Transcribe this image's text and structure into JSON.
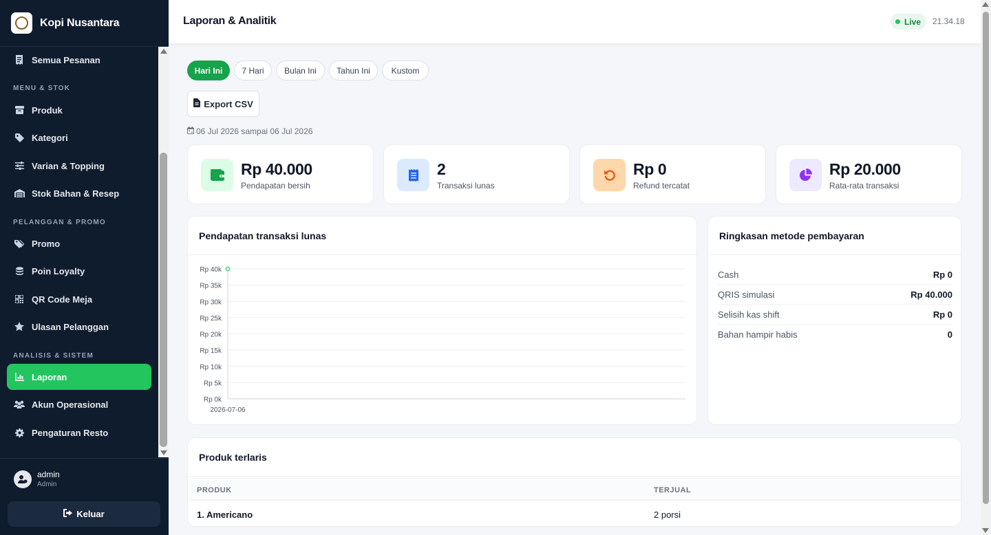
{
  "brand": {
    "name": "Kopi Nusantara"
  },
  "sidebar": {
    "top_item": {
      "label": "Semua Pesanan",
      "icon": "receipt-icon"
    },
    "sections": [
      {
        "title": "MENU & STOK",
        "items": [
          {
            "label": "Produk",
            "icon": "box-icon"
          },
          {
            "label": "Kategori",
            "icon": "tag-icon"
          },
          {
            "label": "Varian & Topping",
            "icon": "sliders-icon"
          },
          {
            "label": "Stok Bahan & Resep",
            "icon": "warehouse-icon"
          }
        ]
      },
      {
        "title": "PELANGGAN & PROMO",
        "items": [
          {
            "label": "Promo",
            "icon": "tags-icon"
          },
          {
            "label": "Poin Loyalty",
            "icon": "coins-icon"
          },
          {
            "label": "QR Code Meja",
            "icon": "qrcode-icon"
          },
          {
            "label": "Ulasan Pelanggan",
            "icon": "star-icon"
          }
        ]
      },
      {
        "title": "ANALISIS & SISTEM",
        "items": [
          {
            "label": "Laporan",
            "icon": "chart-icon",
            "active": true
          },
          {
            "label": "Akun Operasional",
            "icon": "users-icon"
          },
          {
            "label": "Pengaturan Resto",
            "icon": "gear-icon"
          }
        ]
      }
    ]
  },
  "user": {
    "name": "admin",
    "role": "Admin"
  },
  "logout_label": "Keluar",
  "header": {
    "title": "Laporan & Analitik",
    "live_label": "Live",
    "time": "21.34.18"
  },
  "filters": {
    "chips": [
      "Hari Ini",
      "7 Hari",
      "Bulan Ini",
      "Tahun Ini",
      "Kustom"
    ],
    "active": "Hari Ini"
  },
  "export_label": "Export CSV",
  "date_range": "06 Jul 2026 sampai 06 Jul 2026",
  "kpis": [
    {
      "value": "Rp 40.000",
      "label": "Pendapatan bersih",
      "icon": "wallet-icon",
      "color": "#16a34a",
      "bg": "#dcfce7"
    },
    {
      "value": "2",
      "label": "Transaksi lunas",
      "icon": "receipt-icon",
      "color": "#2563eb",
      "bg": "#dbeafe"
    },
    {
      "value": "Rp 0",
      "label": "Refund tercatat",
      "icon": "undo-icon",
      "color": "#ea580c",
      "bg": "#fed7aa"
    },
    {
      "value": "Rp 20.000",
      "label": "Rata-rata transaksi",
      "icon": "pie-icon",
      "color": "#9333ea",
      "bg": "#ede9fe"
    }
  ],
  "revenue_card": {
    "title": "Pendapatan transaksi lunas"
  },
  "chart_data": {
    "type": "line",
    "x": [
      "2026-07-06"
    ],
    "series": [
      {
        "values": [
          40000
        ]
      }
    ],
    "y_ticks": [
      "Rp 0k",
      "Rp 5k",
      "Rp 10k",
      "Rp 15k",
      "Rp 20k",
      "Rp 25k",
      "Rp 30k",
      "Rp 35k",
      "Rp 40k"
    ],
    "ylim": [
      0,
      40000
    ],
    "grid": true,
    "color": "#22c55e"
  },
  "payment_card": {
    "title": "Ringkasan metode pembayaran",
    "rows": [
      {
        "label": "Cash",
        "value": "Rp 0"
      },
      {
        "label": "QRIS simulasi",
        "value": "Rp 40.000"
      },
      {
        "label": "Selisih kas shift",
        "value": "Rp 0"
      },
      {
        "label": "Bahan hampir habis",
        "value": "0"
      }
    ]
  },
  "top_products": {
    "title": "Produk terlaris",
    "columns": [
      "PRODUK",
      "TERJUAL"
    ],
    "rows": [
      {
        "product": "1. Americano",
        "sold": "2 porsi"
      }
    ]
  }
}
